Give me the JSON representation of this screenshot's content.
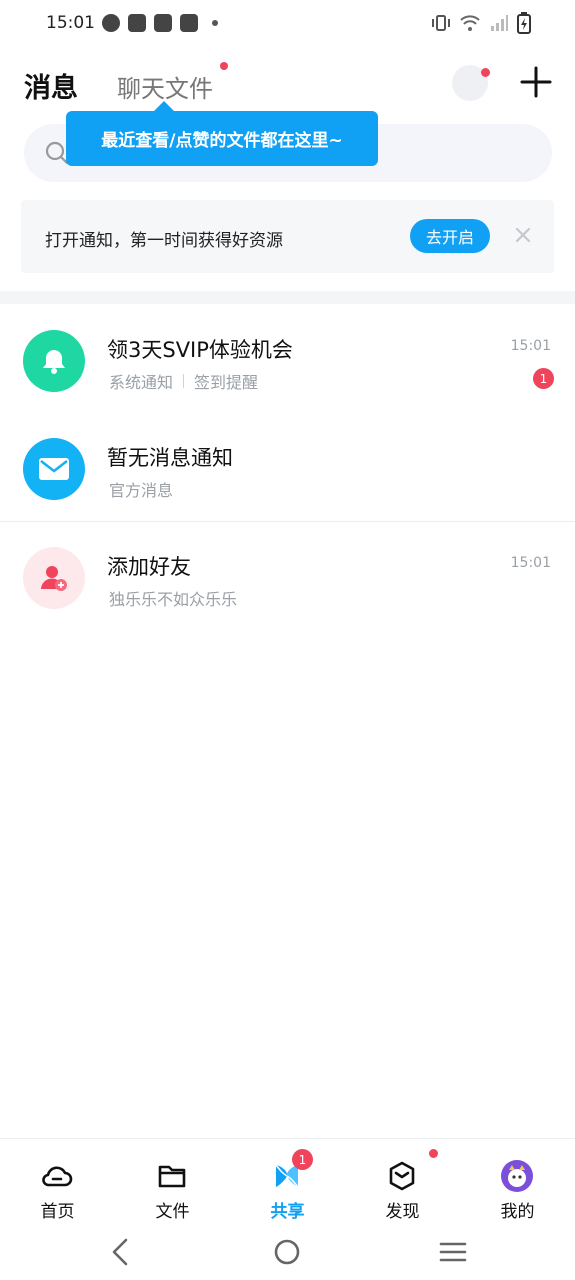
{
  "status_bar": {
    "time": "15:01"
  },
  "header": {
    "tab_messages": "消息",
    "tab_chat_files": "聊天文件"
  },
  "tooltip": {
    "text": "最近查看/点赞的文件都在这里~"
  },
  "notice": {
    "text": "打开通知，第一时间获得好资源",
    "button": "去开启"
  },
  "messages": [
    {
      "title": "领3天SVIP体验机会",
      "sub1": "系统通知",
      "sub2": "签到提醒",
      "time": "15:01",
      "badge": "1",
      "icon": "bell-icon",
      "color": "#1fd7a2"
    },
    {
      "title": "暂无消息通知",
      "sub1": "官方消息",
      "icon": "mail-icon",
      "color": "#13b2f5"
    },
    {
      "title": "添加好友",
      "sub1": "独乐乐不如众乐乐",
      "time": "15:01",
      "icon": "add-friend-icon",
      "color": "#fde9ec"
    }
  ],
  "bottom_nav": [
    {
      "label": "首页",
      "icon": "cloud-icon"
    },
    {
      "label": "文件",
      "icon": "folder-icon"
    },
    {
      "label": "共享",
      "icon": "share-icon",
      "active": true,
      "badge": "1"
    },
    {
      "label": "发现",
      "icon": "discover-icon",
      "dot": true
    },
    {
      "label": "我的",
      "icon": "avatar-icon"
    }
  ],
  "colors": {
    "accent": "#10a1f5",
    "badge": "#f0435c"
  }
}
